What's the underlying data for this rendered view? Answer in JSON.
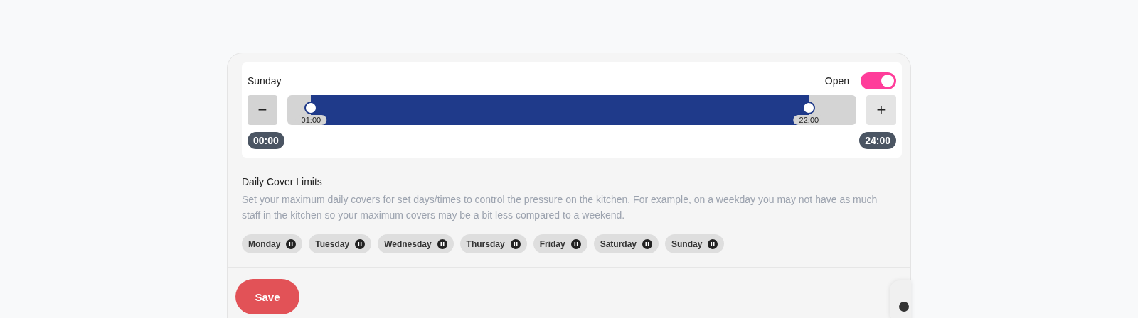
{
  "day_schedule": {
    "day": "Sunday",
    "open_label": "Open",
    "open": true,
    "range": {
      "thumbs": [
        {
          "level": 0.0417,
          "label": "01:00"
        },
        {
          "level": 0.9167,
          "label": "22:00"
        }
      ],
      "min_label": "00:00",
      "max_label": "24:00"
    },
    "minus": "−",
    "plus": "+"
  },
  "cover_limits": {
    "title": "Daily Cover Limits",
    "description": "Set your maximum daily covers for set days/times to control the pressure on the kitchen. For example, on a weekday you may not have as much staff in the kitchen so your maximum covers may be a bit less compared to a weekend.",
    "days": [
      {
        "label": "Monday"
      },
      {
        "label": "Tuesday"
      },
      {
        "label": "Wednesday"
      },
      {
        "label": "Thursday"
      },
      {
        "label": "Friday"
      },
      {
        "label": "Saturday"
      },
      {
        "label": "Sunday"
      }
    ]
  },
  "save": "Save"
}
